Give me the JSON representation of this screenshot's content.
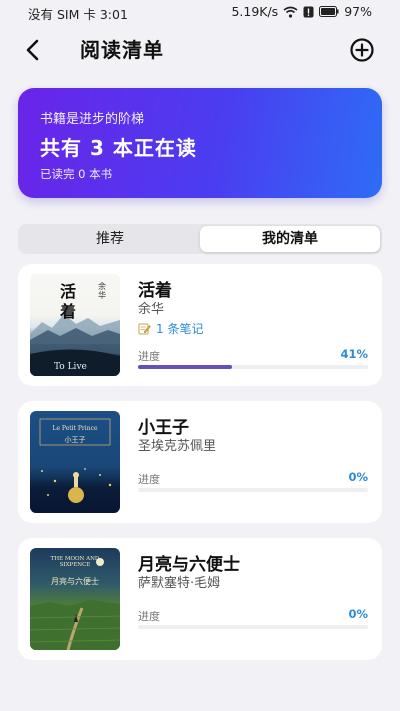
{
  "status_bar": {
    "left": "没有 SIM 卡 3:01",
    "speed": "5.19K/s",
    "battery": "97%"
  },
  "header": {
    "title": "阅读清单"
  },
  "banner": {
    "slogan": "书籍是进步的阶梯",
    "headline": "共有 3 本正在读",
    "subtext": "已读完 0 本书"
  },
  "tabs": [
    {
      "label": "推荐",
      "selected": false
    },
    {
      "label": "我的清单",
      "selected": true
    }
  ],
  "books": [
    {
      "title": "活着",
      "author": "余华",
      "notes": "1 条笔记",
      "progress_label": "进度",
      "progress_text": "41%",
      "progress": 0.41,
      "cover": {
        "title": "活着",
        "author": "余华",
        "en": "To Live"
      }
    },
    {
      "title": "小王子",
      "author": "圣埃克苏佩里",
      "progress_label": "进度",
      "progress_text": "0%",
      "progress": 0,
      "cover": {
        "en": "Le Petit Prince",
        "title": "小王子"
      }
    },
    {
      "title": "月亮与六便士",
      "author": "萨默塞特·毛姆",
      "progress_label": "进度",
      "progress_text": "0%",
      "progress": 0,
      "cover": {
        "en": "THE MOON AND SIXPENCE",
        "title": "月亮与六便士"
      }
    }
  ],
  "colors": {
    "accent": "#2b8bd8",
    "progress_fill": "#6650b8",
    "banner_start": "#6a24e8",
    "banner_end": "#2e6cf6"
  }
}
